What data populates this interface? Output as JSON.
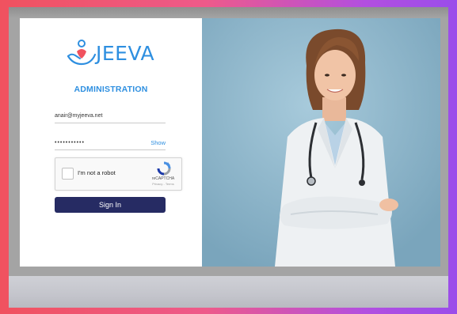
{
  "brand": {
    "name": "JEEVA",
    "subtitle": "ADMINISTRATION",
    "color": "#2e8fe0"
  },
  "login_form": {
    "email_value": "anair@myjeeva.net",
    "password_value": "•••••••••••",
    "show_label": "Show",
    "recaptcha": {
      "label": "I'm not a robot",
      "brand": "reCAPTCHA",
      "terms": "Privacy - Terms",
      "checked": false
    },
    "signin_label": "Sign In",
    "signin_color": "#262b63"
  },
  "hero_image": {
    "icon": "doctor-portrait",
    "background": "#8fb8cc"
  },
  "frame": {
    "gradient_start": "#f0525f",
    "gradient_end": "#9a4dea"
  }
}
